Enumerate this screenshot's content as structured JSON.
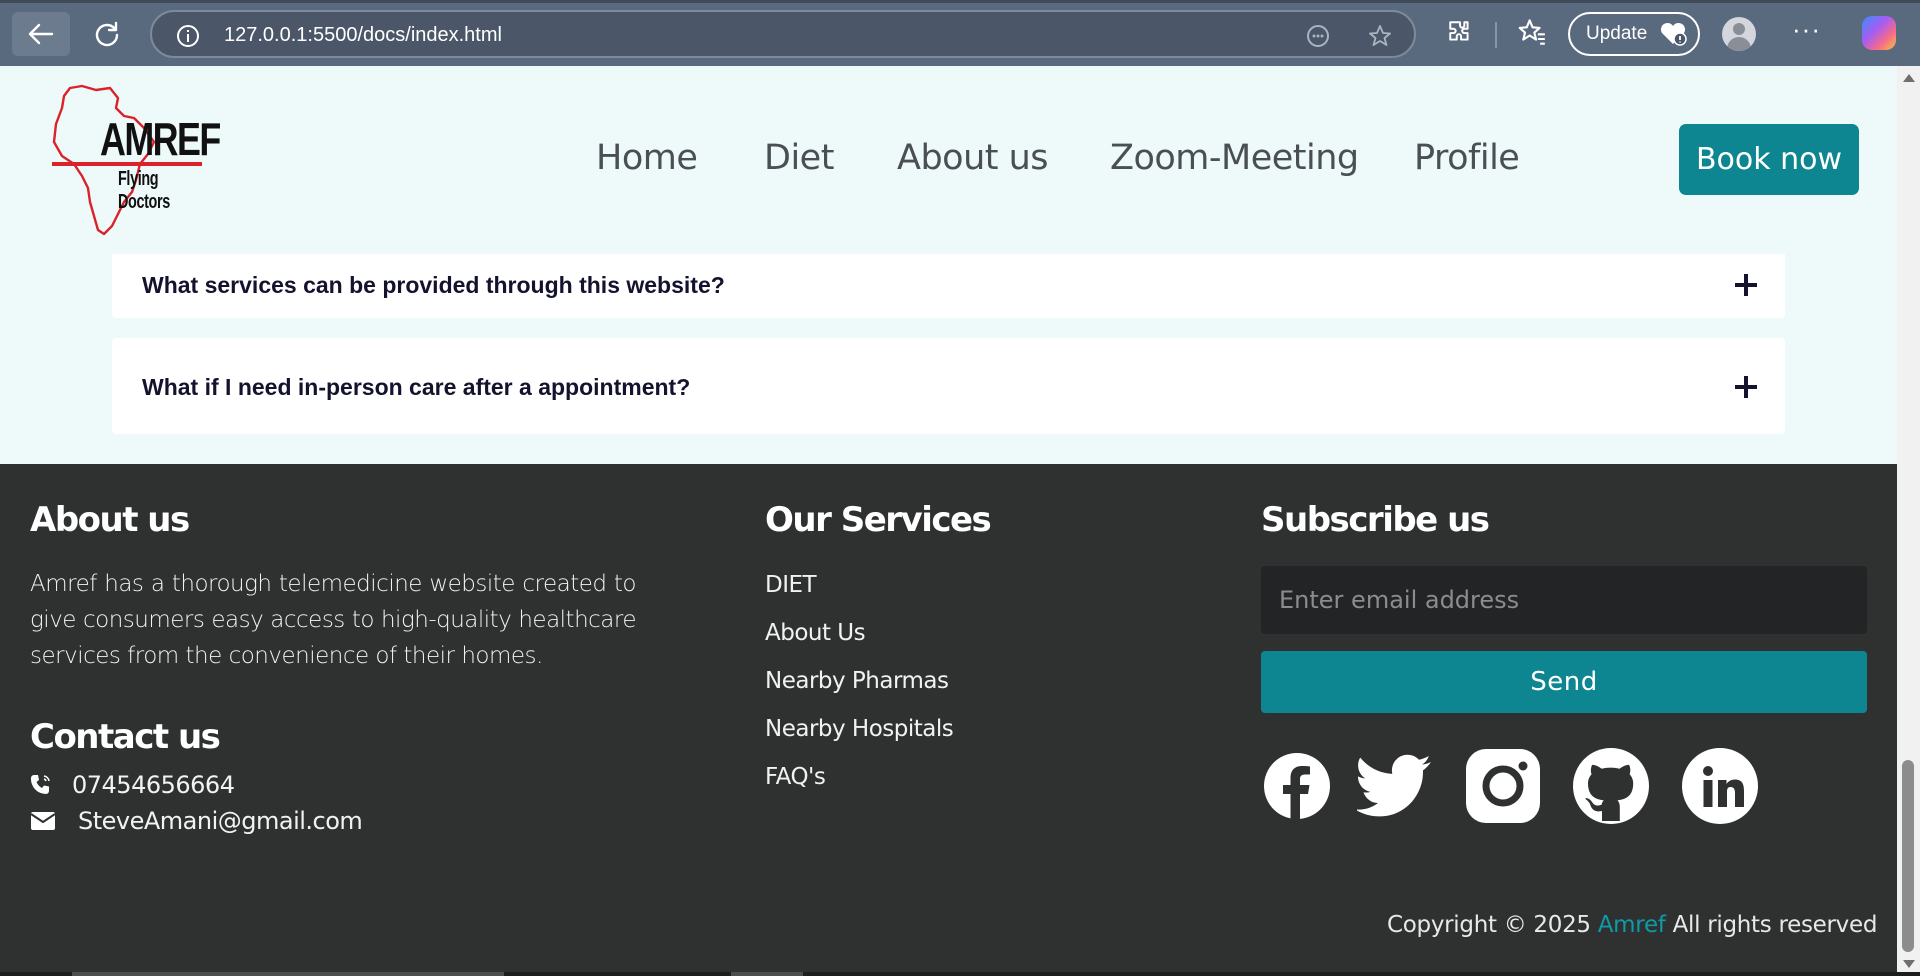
{
  "browser": {
    "url": "127.0.0.1:5500/docs/index.html",
    "update_label": "Update",
    "more_label": "···"
  },
  "header": {
    "logo_title": "AMREF",
    "logo_subtitle": "Flying Doctors",
    "nav": [
      "Home",
      "Diet",
      "About us",
      "Zoom-Meeting",
      "Profile"
    ],
    "book_label": "Book now"
  },
  "faq": [
    {
      "question": "What services can be provided through this website?"
    },
    {
      "question": "What if I need in-person care after a appointment?"
    }
  ],
  "footer": {
    "about_heading": "About us",
    "about_text": "Amref has a thorough telemedicine website created to give consumers easy access to high-quality healthcare services from the convenience of their homes.",
    "contact_heading": "Contact us",
    "phone": "07454656664",
    "email": "SteveAmani@gmail.com",
    "services_heading": "Our Services",
    "services": [
      "DIET",
      "About Us",
      "Nearby Pharmas",
      "Nearby Hospitals",
      "FAQ's"
    ],
    "subscribe_heading": "Subscribe us",
    "email_placeholder": "Enter email address",
    "send_label": "Send",
    "social": [
      "facebook-icon",
      "twitter-icon",
      "instagram-icon",
      "github-icon",
      "linkedin-icon"
    ],
    "copyright_prefix": "Copyright © 2025 ",
    "copyright_brand": "Amref",
    "copyright_suffix": " All rights reserved"
  },
  "colors": {
    "accent": "#0e8691",
    "page_bg": "#edfaf9",
    "footer_bg": "#2f3131",
    "logo_red": "#d9222a"
  }
}
